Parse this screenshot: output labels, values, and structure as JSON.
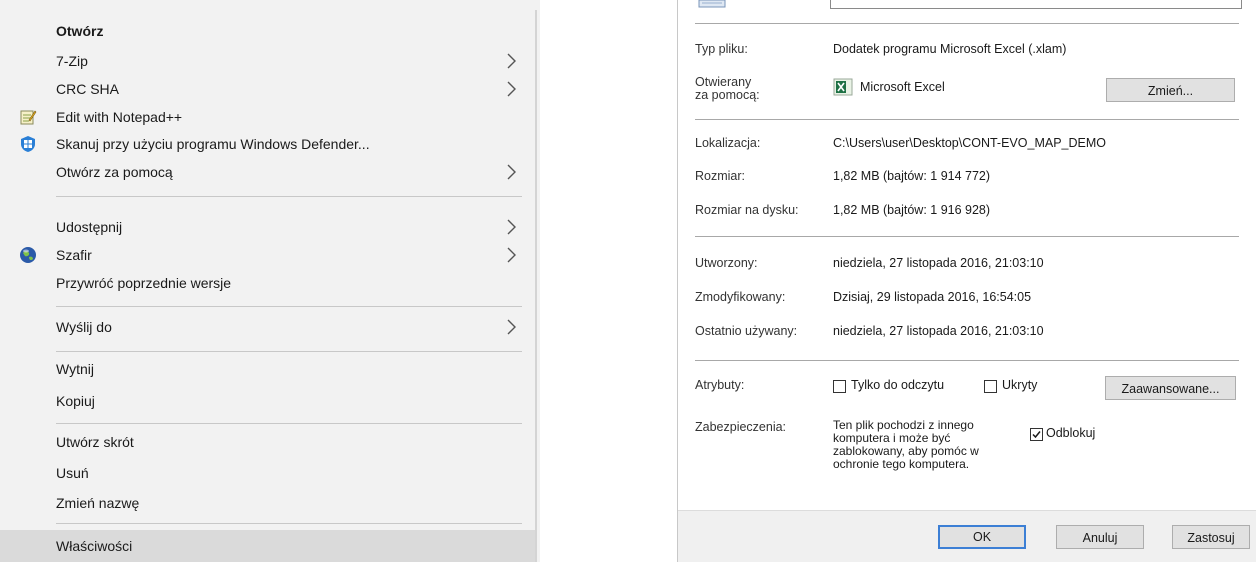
{
  "context_menu": {
    "items": [
      {
        "label": "Otwórz"
      },
      {
        "label": "7-Zip"
      },
      {
        "label": "CRC SHA"
      },
      {
        "label": "Edit with Notepad++"
      },
      {
        "label": "Skanuj przy użyciu programu Windows Defender..."
      },
      {
        "label": "Otwórz za pomocą"
      },
      {
        "label": "Udostępnij"
      },
      {
        "label": "Szafir"
      },
      {
        "label": "Przywróć poprzednie wersje"
      },
      {
        "label": "Wyślij do"
      },
      {
        "label": "Wytnij"
      },
      {
        "label": "Kopiuj"
      },
      {
        "label": "Utwórz skrót"
      },
      {
        "label": "Usuń"
      },
      {
        "label": "Zmień nazwę"
      },
      {
        "label": "Właściwości"
      }
    ],
    "icons": {
      "notepad": "notepad-plus-icon",
      "defender": "windows-defender-icon",
      "szafir": "szafir-globe-icon",
      "submenu": "chevron-right-icon"
    }
  },
  "properties": {
    "file_type_label": "Typ pliku:",
    "file_type_value": "Dodatek programu Microsoft Excel (.xlam)",
    "opens_with_label_1": "Otwierany",
    "opens_with_label_2": "za pomocą:",
    "opens_with_value": "Microsoft Excel",
    "change_button": "Zmień...",
    "location_label": "Lokalizacja:",
    "location_value": "C:\\Users\\user\\Desktop\\CONT-EVO_MAP_DEMO",
    "size_label": "Rozmiar:",
    "size_value": "1,82 MB (bajtów: 1 914 772)",
    "size_on_disk_label": "Rozmiar na dysku:",
    "size_on_disk_value": "1,82 MB (bajtów: 1 916 928)",
    "created_label": "Utworzony:",
    "created_value": "niedziela, 27 listopada 2016, 21:03:10",
    "modified_label": "Zmodyfikowany:",
    "modified_value": "Dzisiaj, 29 listopada 2016, 16:54:05",
    "accessed_label": "Ostatnio używany:",
    "accessed_value": "niedziela, 27 listopada 2016, 21:03:10",
    "attributes_label": "Atrybuty:",
    "readonly_label": "Tylko do odczytu",
    "hidden_label": "Ukryty",
    "advanced_button": "Zaawansowane...",
    "security_label": "Zabezpieczenia:",
    "security_text_1": "Ten plik pochodzi z innego",
    "security_text_2": "komputera i może być",
    "security_text_3": "zablokowany, aby pomóc w",
    "security_text_4": "ochronie tego komputera.",
    "unblock_label": "Odblokuj",
    "readonly_checked": false,
    "hidden_checked": false,
    "unblock_checked": true,
    "ok_button": "OK",
    "cancel_button": "Anuluj",
    "apply_button": "Zastosuj"
  }
}
